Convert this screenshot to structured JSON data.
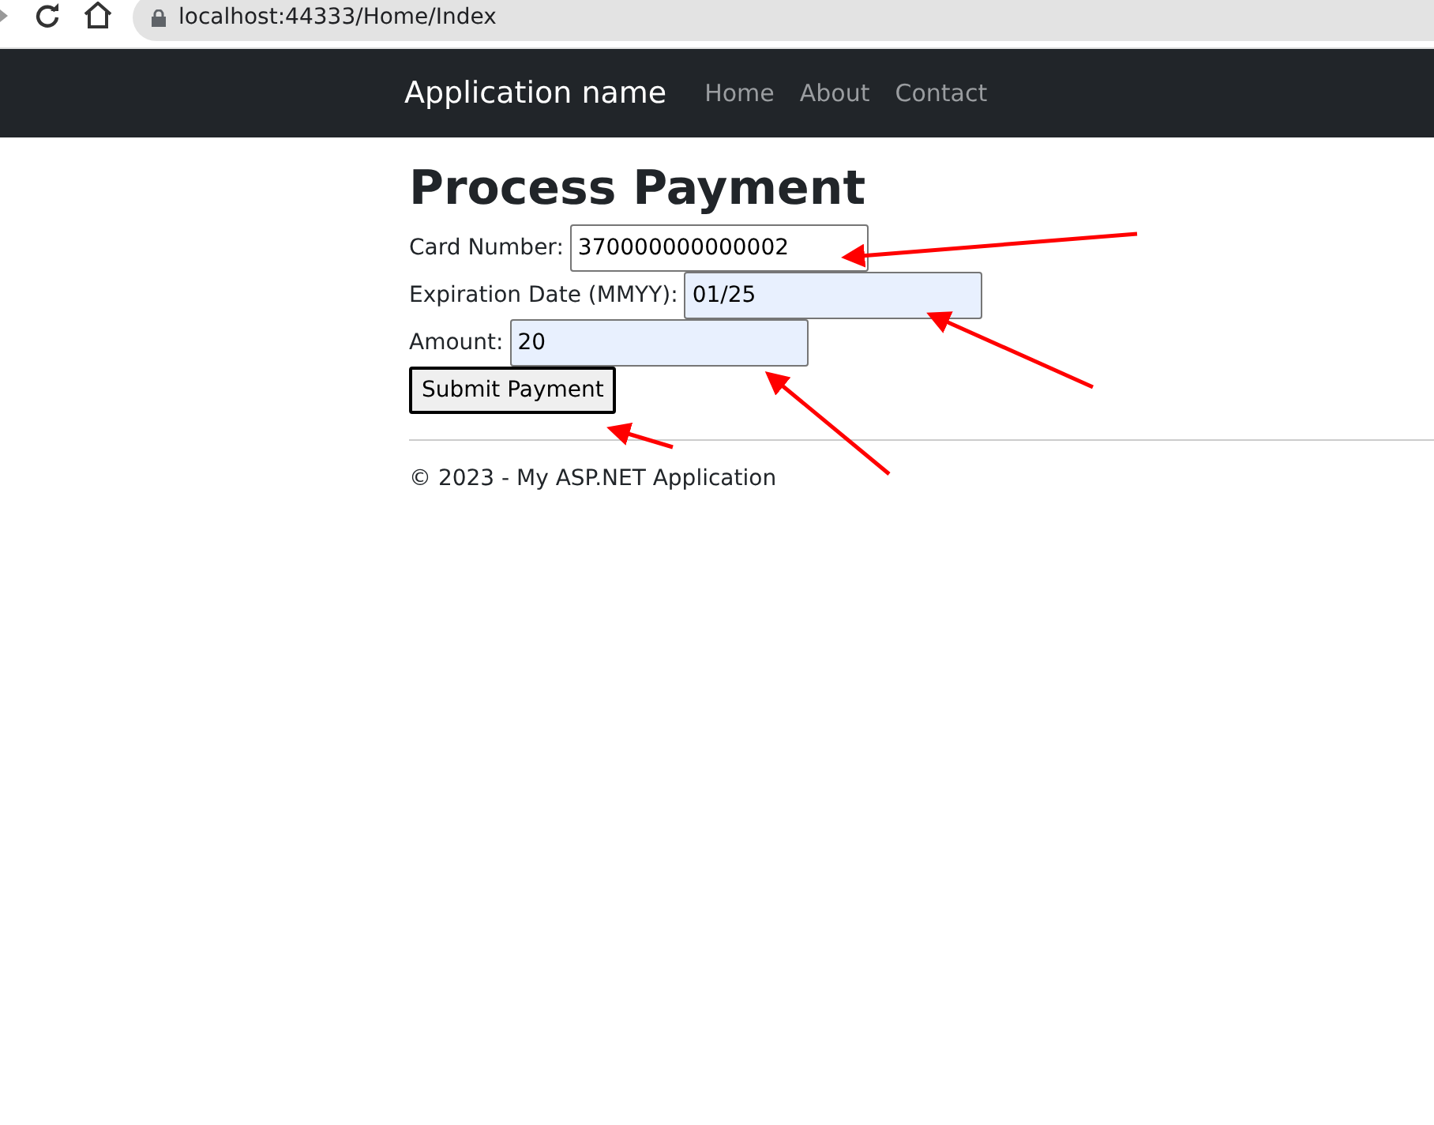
{
  "browser": {
    "address": "localhost:44333/Home/Index"
  },
  "navbar": {
    "brand": "Application name",
    "links": [
      {
        "label": "Home"
      },
      {
        "label": "About"
      },
      {
        "label": "Contact"
      }
    ]
  },
  "heading": "Process Payment",
  "fields": [
    {
      "label": "Card Number:",
      "value": "370000000000002",
      "autofilled": false
    },
    {
      "label": "Expiration Date (MMYY):",
      "value": "01/25",
      "autofilled": true
    },
    {
      "label": "Amount:",
      "value": "20",
      "autofilled": true
    }
  ],
  "submit_button": "Submit Payment",
  "footer": "© 2023 - My ASP.NET Application"
}
